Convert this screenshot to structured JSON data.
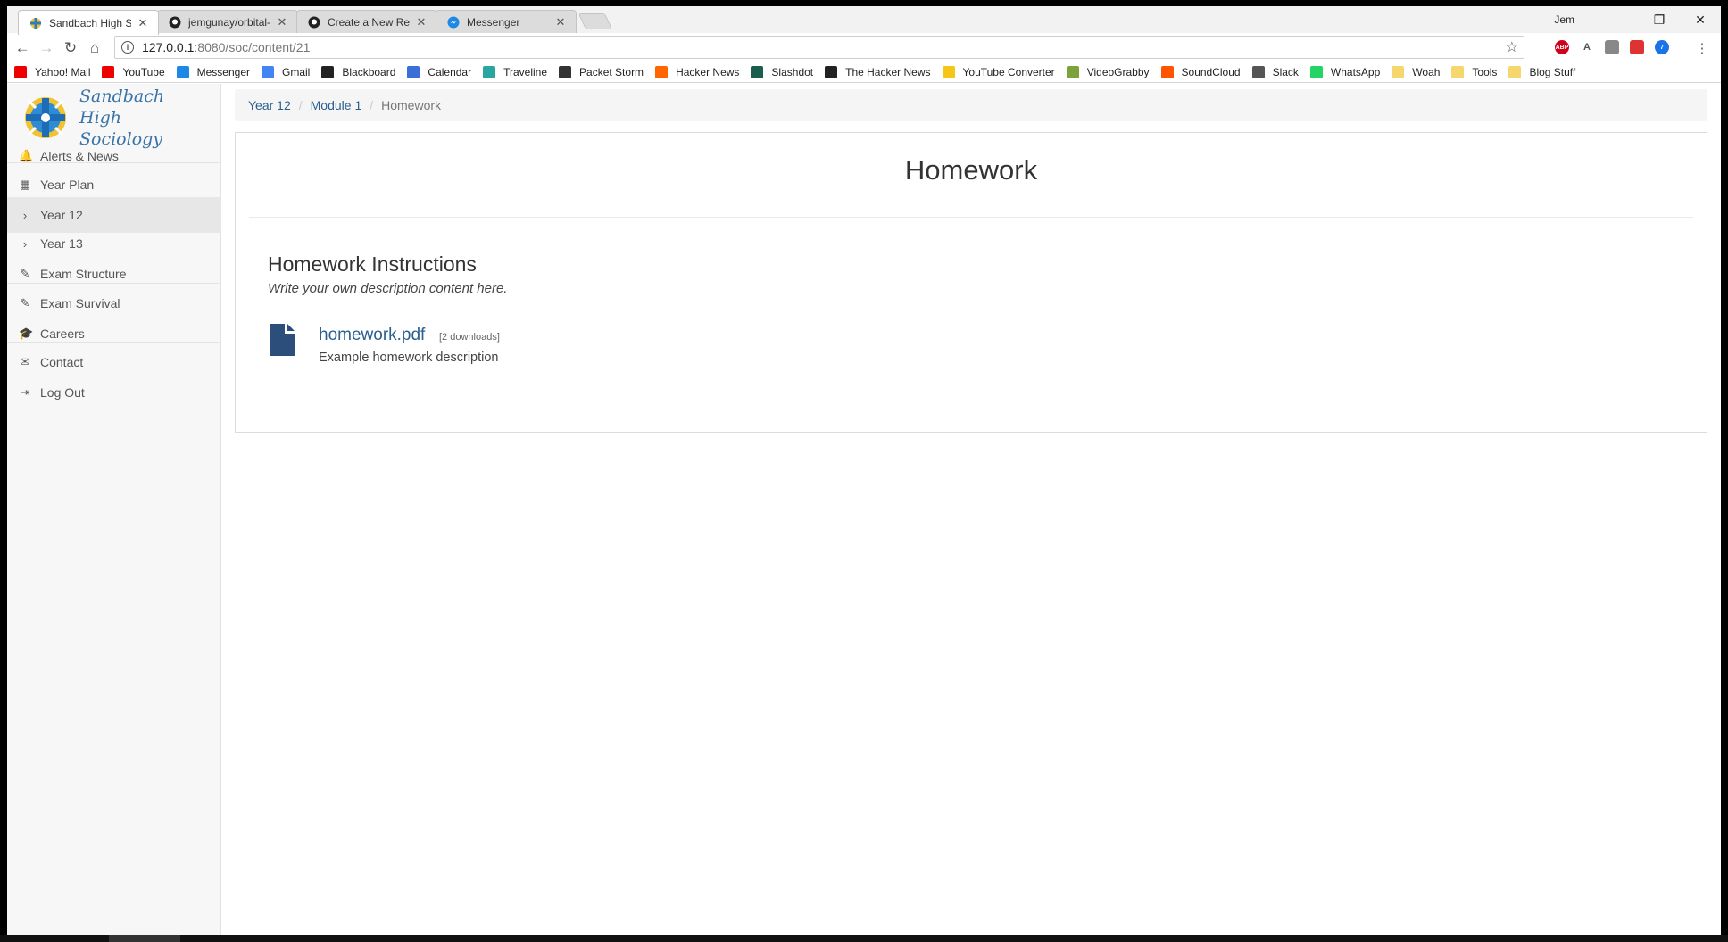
{
  "browser": {
    "tabs": [
      {
        "title": "Sandbach High Sociology",
        "icon": "cross-logo-icon",
        "active": true
      },
      {
        "title": "jemgunay/orbital-sim: D",
        "icon": "github-icon",
        "active": false
      },
      {
        "title": "Create a New Repository",
        "icon": "github-icon",
        "active": false
      },
      {
        "title": "Messenger",
        "icon": "messenger-icon",
        "active": false
      }
    ],
    "profile_name": "Jem",
    "address": {
      "host": "127.0.0.1",
      "path": ":8080/soc/content/21"
    },
    "bookmarks": [
      {
        "label": "Yahoo! Mail",
        "icon": "youtube-red-icon",
        "color": "#e00"
      },
      {
        "label": "YouTube",
        "icon": "youtube-icon",
        "color": "#e00"
      },
      {
        "label": "Messenger",
        "icon": "messenger-icon",
        "color": "#1e88e5"
      },
      {
        "label": "Gmail",
        "icon": "google-icon",
        "color": "#4285f4"
      },
      {
        "label": "Blackboard",
        "icon": "blackboard-icon",
        "color": "#222"
      },
      {
        "label": "Calendar",
        "icon": "calendar-icon",
        "color": "#3b6fd8"
      },
      {
        "label": "Traveline",
        "icon": "traveline-icon",
        "color": "#2aa6a0"
      },
      {
        "label": "Packet Storm",
        "icon": "packetstorm-icon",
        "color": "#333"
      },
      {
        "label": "Hacker News",
        "icon": "hackernews-icon",
        "color": "#ff6600"
      },
      {
        "label": "Slashdot",
        "icon": "slashdot-icon",
        "color": "#1b5e4e"
      },
      {
        "label": "The Hacker News",
        "icon": "thehackernews-icon",
        "color": "#222"
      },
      {
        "label": "YouTube Converter",
        "icon": "converter-icon",
        "color": "#f5c518"
      },
      {
        "label": "VideoGrabby",
        "icon": "videograbby-icon",
        "color": "#7aa33a"
      },
      {
        "label": "SoundCloud",
        "icon": "soundcloud-icon",
        "color": "#ff5500"
      },
      {
        "label": "Slack",
        "icon": "slack-icon",
        "color": "#555"
      },
      {
        "label": "WhatsApp",
        "icon": "whatsapp-icon",
        "color": "#25d366"
      },
      {
        "label": "Woah",
        "icon": "folder-icon",
        "color": "#f5d76e"
      },
      {
        "label": "Tools",
        "icon": "folder-icon",
        "color": "#f5d76e"
      },
      {
        "label": "Blog Stuff",
        "icon": "folder-icon",
        "color": "#f5d76e"
      }
    ],
    "extensions": [
      {
        "name": "adblock-icon",
        "text": "ABP",
        "color": "#d0021b"
      },
      {
        "name": "translate-icon",
        "text": "A",
        "color": "#666"
      },
      {
        "name": "extension-icon",
        "text": "",
        "color": "#888"
      },
      {
        "name": "red-extension-icon",
        "text": "",
        "color": "#d33"
      },
      {
        "name": "gear-badge-icon",
        "text": "7",
        "color": "#1a73e8"
      }
    ]
  },
  "site": {
    "brand_line1": "Sandbach High",
    "brand_line2": "Sociology",
    "nav": [
      {
        "label": "Alerts & News",
        "icon": "bell-icon",
        "glyph": "🔔"
      },
      {
        "label": "Year Plan",
        "icon": "calendar-icon",
        "glyph": "▦"
      },
      {
        "label": "Year 12",
        "icon": "chevron-right-icon",
        "glyph": "›",
        "active": true
      },
      {
        "label": "Year 13",
        "icon": "chevron-right-icon",
        "glyph": "›"
      },
      {
        "label": "Exam Structure",
        "icon": "pencil-icon",
        "glyph": "✎"
      },
      {
        "label": "Exam Survival",
        "icon": "pencil-icon",
        "glyph": "✎"
      },
      {
        "label": "Careers",
        "icon": "graduation-cap-icon",
        "glyph": "🎓"
      },
      {
        "label": "Contact",
        "icon": "envelope-icon",
        "glyph": "✉"
      },
      {
        "label": "Log Out",
        "icon": "logout-icon",
        "glyph": "⇥"
      }
    ]
  },
  "breadcrumb": {
    "items": [
      "Year 12",
      "Module 1"
    ],
    "current": "Homework"
  },
  "content": {
    "title": "Homework",
    "section_heading": "Homework Instructions",
    "section_description": "Write your own description content here.",
    "file": {
      "name": "homework.pdf",
      "downloads": "[2 downloads]",
      "description": "Example homework description"
    }
  },
  "colors": {
    "link": "#2a5f8f",
    "brand": "#3a74a8",
    "file_icon": "#2b4f7a"
  }
}
